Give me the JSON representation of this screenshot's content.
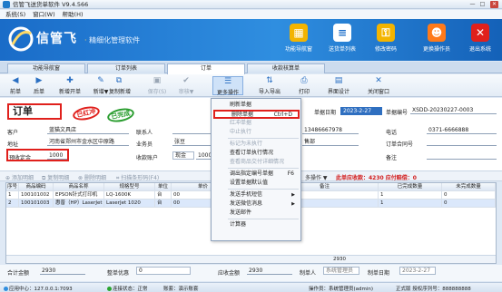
{
  "window": {
    "title": "信管飞送货单软件 V9.4.566",
    "min": "—",
    "max": "□",
    "close": "✕"
  },
  "menu": [
    "系统(S)",
    "窗口(W)",
    "帮助(H)"
  ],
  "banner": {
    "logo": "信管飞",
    "slogan_dot": "·",
    "slogan": "精细化管理软件",
    "buttons": [
      {
        "label": "功能导航窗",
        "icon": "grid-icon",
        "color": "#f3b400",
        "glyph": "▦"
      },
      {
        "label": "送货单列表",
        "icon": "list-icon",
        "color": "#ffffff",
        "glyph": "≡"
      },
      {
        "label": "修改密码",
        "icon": "lock-icon",
        "color": "#f3b400",
        "glyph": "⚿"
      },
      {
        "label": "更换操作员",
        "icon": "user-switch-icon",
        "color": "#ff7a1a",
        "glyph": "☻"
      },
      {
        "label": "退出系统",
        "icon": "exit-icon",
        "color": "#e0201c",
        "glyph": "✕"
      }
    ]
  },
  "tabs": [
    "功能导航窗",
    "订单列表",
    "订单",
    "收款核算单"
  ],
  "active_tab": "订单",
  "toolbar": [
    {
      "label": "前单",
      "glyph": "◀"
    },
    {
      "label": "后单",
      "glyph": "▶"
    },
    {
      "label": "新增开单",
      "glyph": "✚"
    },
    {
      "label": "新增▼",
      "glyph": "✎"
    },
    {
      "label": "复制新增",
      "glyph": "⧉"
    },
    {
      "label": "保存(S)",
      "glyph": "▣",
      "dim": true
    },
    {
      "label": "审核▼",
      "glyph": "✔",
      "dim": true
    },
    {
      "label": "更多操作",
      "glyph": "☰",
      "hot": true
    },
    {
      "label": "导入导出",
      "glyph": "⇅"
    },
    {
      "label": "打印",
      "glyph": "⎙"
    },
    {
      "label": "界面设计",
      "glyph": "▤"
    },
    {
      "label": "关闭窗口",
      "glyph": "✕"
    }
  ],
  "form": {
    "doc_title": "订单",
    "stamp_red": "已红冲",
    "stamp_green": "已完成",
    "order_date_label": "单据日期",
    "order_date": "2023-2-27",
    "order_no_label": "单据编号",
    "order_no": "XSDD-20230227-0003",
    "customer_label": "客户",
    "customer": "蓝猫文具店",
    "contact_label": "联系人",
    "contact": "",
    "mobile": "13486667978",
    "phone_label": "电话",
    "phone": "0371-6666888",
    "address_label": "地址",
    "address": "河南省郑州市金水区中原路",
    "salesman_label": "业务员",
    "salesman": "张豆",
    "dept": "售部",
    "po_label": "订单合同号",
    "po": "",
    "deposit_label": "预收定金",
    "deposit": "1000",
    "account_label": "收款账户",
    "account": "现金",
    "account_amount": "1000",
    "remark_label": "备注",
    "remark": ""
  },
  "subbar": {
    "buttons": [
      "添加明细",
      "复制明细",
      "删除明细",
      "扫描条形码(F4)"
    ],
    "batch": "多操作 ▼",
    "summary": "此单应收款：4230  应付赔偿：0"
  },
  "grid": {
    "columns": [
      "序号",
      "商品编码",
      "商品名称",
      "规格型号",
      "单位",
      "单价",
      "金额",
      "备注",
      "已完成数量",
      "未完成数量"
    ],
    "rows": [
      [
        "1",
        "100101002",
        "EPSON针式打印机",
        "LQ-1600K",
        "台",
        "00",
        "1750",
        "",
        "1",
        "0"
      ],
      [
        "2",
        "100101003",
        "惠普（HP）LaserJet",
        "LaserJet 1020",
        "台",
        "00",
        "1180",
        "",
        "1",
        "0"
      ]
    ],
    "total": "2930"
  },
  "footer": {
    "total_label": "合计金额",
    "total": "2930",
    "discount_label": "整单优惠",
    "discount": "0",
    "receivable_label": "应收金额",
    "receivable": "2930",
    "maker_label": "制单人",
    "maker": "系统管理员",
    "make_date_label": "制单日期",
    "make_date": "2023-2-27"
  },
  "status": {
    "server": "应用中心：127.0.0.1:7093",
    "conn": "连接状态：正常",
    "account": "账套：演示账套",
    "operator": "操作员：系统管理员(admin)",
    "license": "正式版  授权序列号：888888888"
  },
  "dropdown": [
    {
      "label": "刷新单据",
      "dis": false
    },
    {
      "label": "删除单据",
      "shortcut": "Ctrl+D",
      "highlight": true
    },
    {
      "label": "红冲单据",
      "dis": true
    },
    {
      "label": "中止执行",
      "dis": true
    },
    {
      "sep": true
    },
    {
      "label": "标记为未执行",
      "dis": true
    },
    {
      "label": "查看订单执行情况",
      "dis": false
    },
    {
      "label": "查看商品交付详细情况",
      "dis": true
    },
    {
      "sep": true
    },
    {
      "label": "调出指定编号单据",
      "shortcut": "F6",
      "dis": false
    },
    {
      "label": "设置单据默认值",
      "dis": false
    },
    {
      "sep": true
    },
    {
      "label": "发送手机短信",
      "arrow": true,
      "dis": false
    },
    {
      "label": "发送微信消息",
      "arrow": true,
      "dis": false
    },
    {
      "label": "发送邮件",
      "dis": false
    },
    {
      "sep": true
    },
    {
      "label": "计算器",
      "dis": false
    }
  ]
}
